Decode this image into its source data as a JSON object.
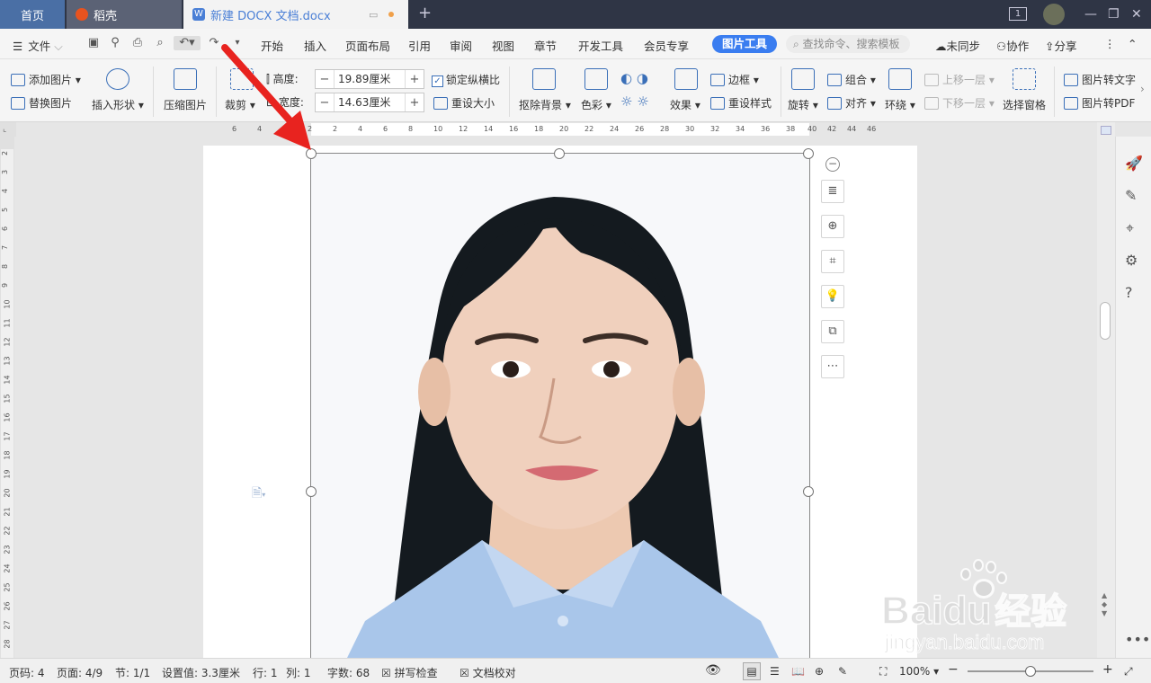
{
  "tabs": {
    "home": "首页",
    "daoke": "稻壳",
    "doc": "新建 DOCX 文档.docx"
  },
  "window": {
    "badge": "1"
  },
  "menubar": {
    "file": "文件",
    "items": [
      "开始",
      "插入",
      "页面布局",
      "引用",
      "审阅",
      "视图",
      "章节",
      "开发工具",
      "会员专享"
    ],
    "active_tab": "图片工具",
    "search_placeholder": "查找命令、搜索模板",
    "sync": "未同步",
    "collab": "协作",
    "share": "分享"
  },
  "ribbon": {
    "add_picture": "添加图片",
    "replace_picture": "替换图片",
    "insert_shape": "插入形状",
    "compress": "压缩图片",
    "crop": "裁剪",
    "height_label": "高度:",
    "height_value": "19.89厘米",
    "width_label": "宽度:",
    "width_value": "14.63厘米",
    "lock_ratio": "锁定纵横比",
    "reset_size": "重设大小",
    "remove_bg": "抠除背景",
    "color": "色彩",
    "effects": "效果",
    "border": "边框",
    "reset_style": "重设样式",
    "rotate": "旋转",
    "group": "组合",
    "align": "对齐",
    "wrap": "环绕",
    "bring_forward": "上移一层",
    "send_backward": "下移一层",
    "select_pane": "选择窗格",
    "pic_to_text": "图片转文字",
    "pic_to_pdf": "图片转PDF"
  },
  "ruler": {
    "h_left": [
      "6",
      "4"
    ],
    "h_main": [
      "2",
      "2",
      "4",
      "6",
      "8",
      "10",
      "12",
      "14",
      "16",
      "18",
      "20",
      "22",
      "24",
      "26",
      "28",
      "30",
      "32",
      "34",
      "36",
      "38"
    ],
    "h_right": [
      "40",
      "42",
      "44",
      "46"
    ],
    "v": [
      "2",
      "3",
      "4",
      "5",
      "6",
      "7",
      "8",
      "9",
      "10",
      "11",
      "12",
      "13",
      "14",
      "15",
      "16",
      "17",
      "18",
      "19",
      "20",
      "21",
      "22",
      "23",
      "24",
      "25",
      "26",
      "27",
      "28"
    ]
  },
  "statusbar": {
    "page_code": "页码: 4",
    "page": "页面: 4/9",
    "section": "节: 1/1",
    "setting": "设置值: 3.3厘米",
    "row": "行: 1",
    "col": "列: 1",
    "words": "字数: 68",
    "spellcheck": "拼写检查",
    "proof": "文档校对",
    "zoom": "100%"
  },
  "watermark": {
    "brand": "Baidu",
    "cn": "经验",
    "url": "jingyan.baidu.com"
  },
  "colors": {
    "accent": "#3a7df0",
    "arrow": "#e8231f",
    "titlebar": "#2f3545",
    "shirt": "#a9c6ea"
  }
}
